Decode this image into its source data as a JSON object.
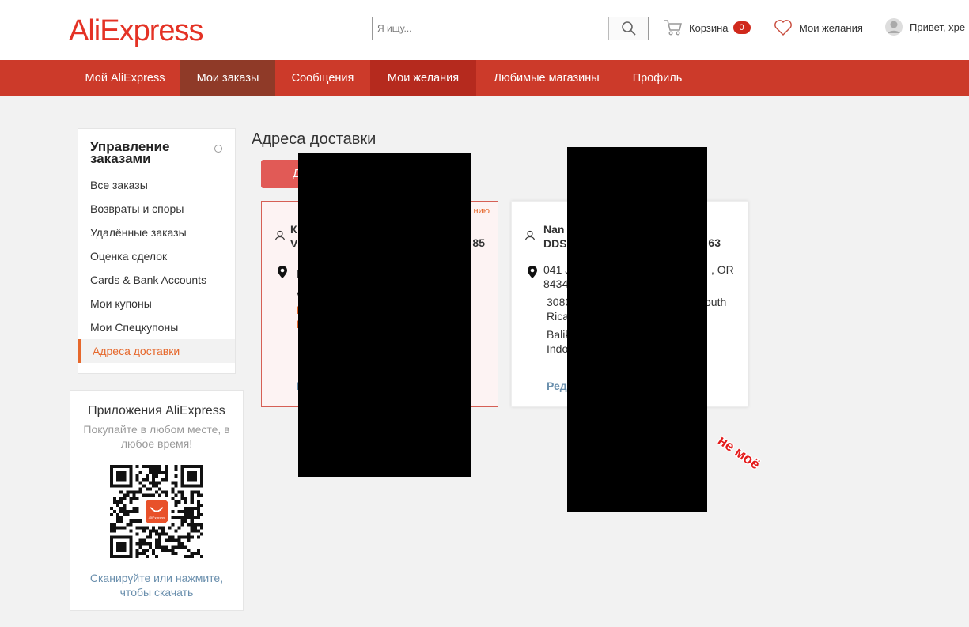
{
  "header": {
    "logo_text": "AliExpress",
    "search_placeholder": "Я ищу...",
    "cart_label": "Корзина",
    "cart_count": "0",
    "wishlist_label": "Мои желания",
    "greeting": "Привет, хре"
  },
  "nav": {
    "items": [
      {
        "label": "Мой AliExpress"
      },
      {
        "label": "Мои заказы"
      },
      {
        "label": "Сообщения"
      },
      {
        "label": "Мои желания"
      },
      {
        "label": "Любимые магазины"
      },
      {
        "label": "Профиль"
      }
    ]
  },
  "sidebar": {
    "title": "Управление заказами",
    "items": [
      {
        "label": "Все заказы"
      },
      {
        "label": "Возвраты и споры"
      },
      {
        "label": "Удалённые заказы"
      },
      {
        "label": "Оценка сделок"
      },
      {
        "label": "Cards & Bank Accounts"
      },
      {
        "label": "Мои купоны"
      },
      {
        "label": "Мои Спецкупоны"
      },
      {
        "label": "Адреса доставки"
      }
    ]
  },
  "app_promo": {
    "title": "Приложения AliExpress",
    "subtitle": "Покупайте в любом месте, в любое время!",
    "qr_logo_text": "AliExpress",
    "link": "Сканируйте или нажмите, чтобы скачать"
  },
  "main": {
    "title": "Адреса доставки",
    "add_button": "Д"
  },
  "addresses": [
    {
      "default_tag": "нию",
      "name_line1": "К",
      "name_line2": "V",
      "phone": "85",
      "line1": "Р",
      "line2": "V",
      "line3": "I",
      "line4": "I",
      "edit": "I"
    },
    {
      "name_line1": "Nan",
      "name_line2": "DDS",
      "phone": "63",
      "line1a": "041 J",
      "line1b": ", OR",
      "line1c": "8434",
      "line2a": "3080",
      "line2b": "outh",
      "line2c": "Rica",
      "line3a": "Balik",
      "line3b": "Indo",
      "edit": "Реда"
    }
  ],
  "annotation": "не моё",
  "colors": {
    "brand_red": "#cc3a2a",
    "nav_active": "#8f3a28",
    "accent_orange": "#e6682c",
    "add_button": "#e15a56",
    "link_blue": "#6a8fad"
  }
}
